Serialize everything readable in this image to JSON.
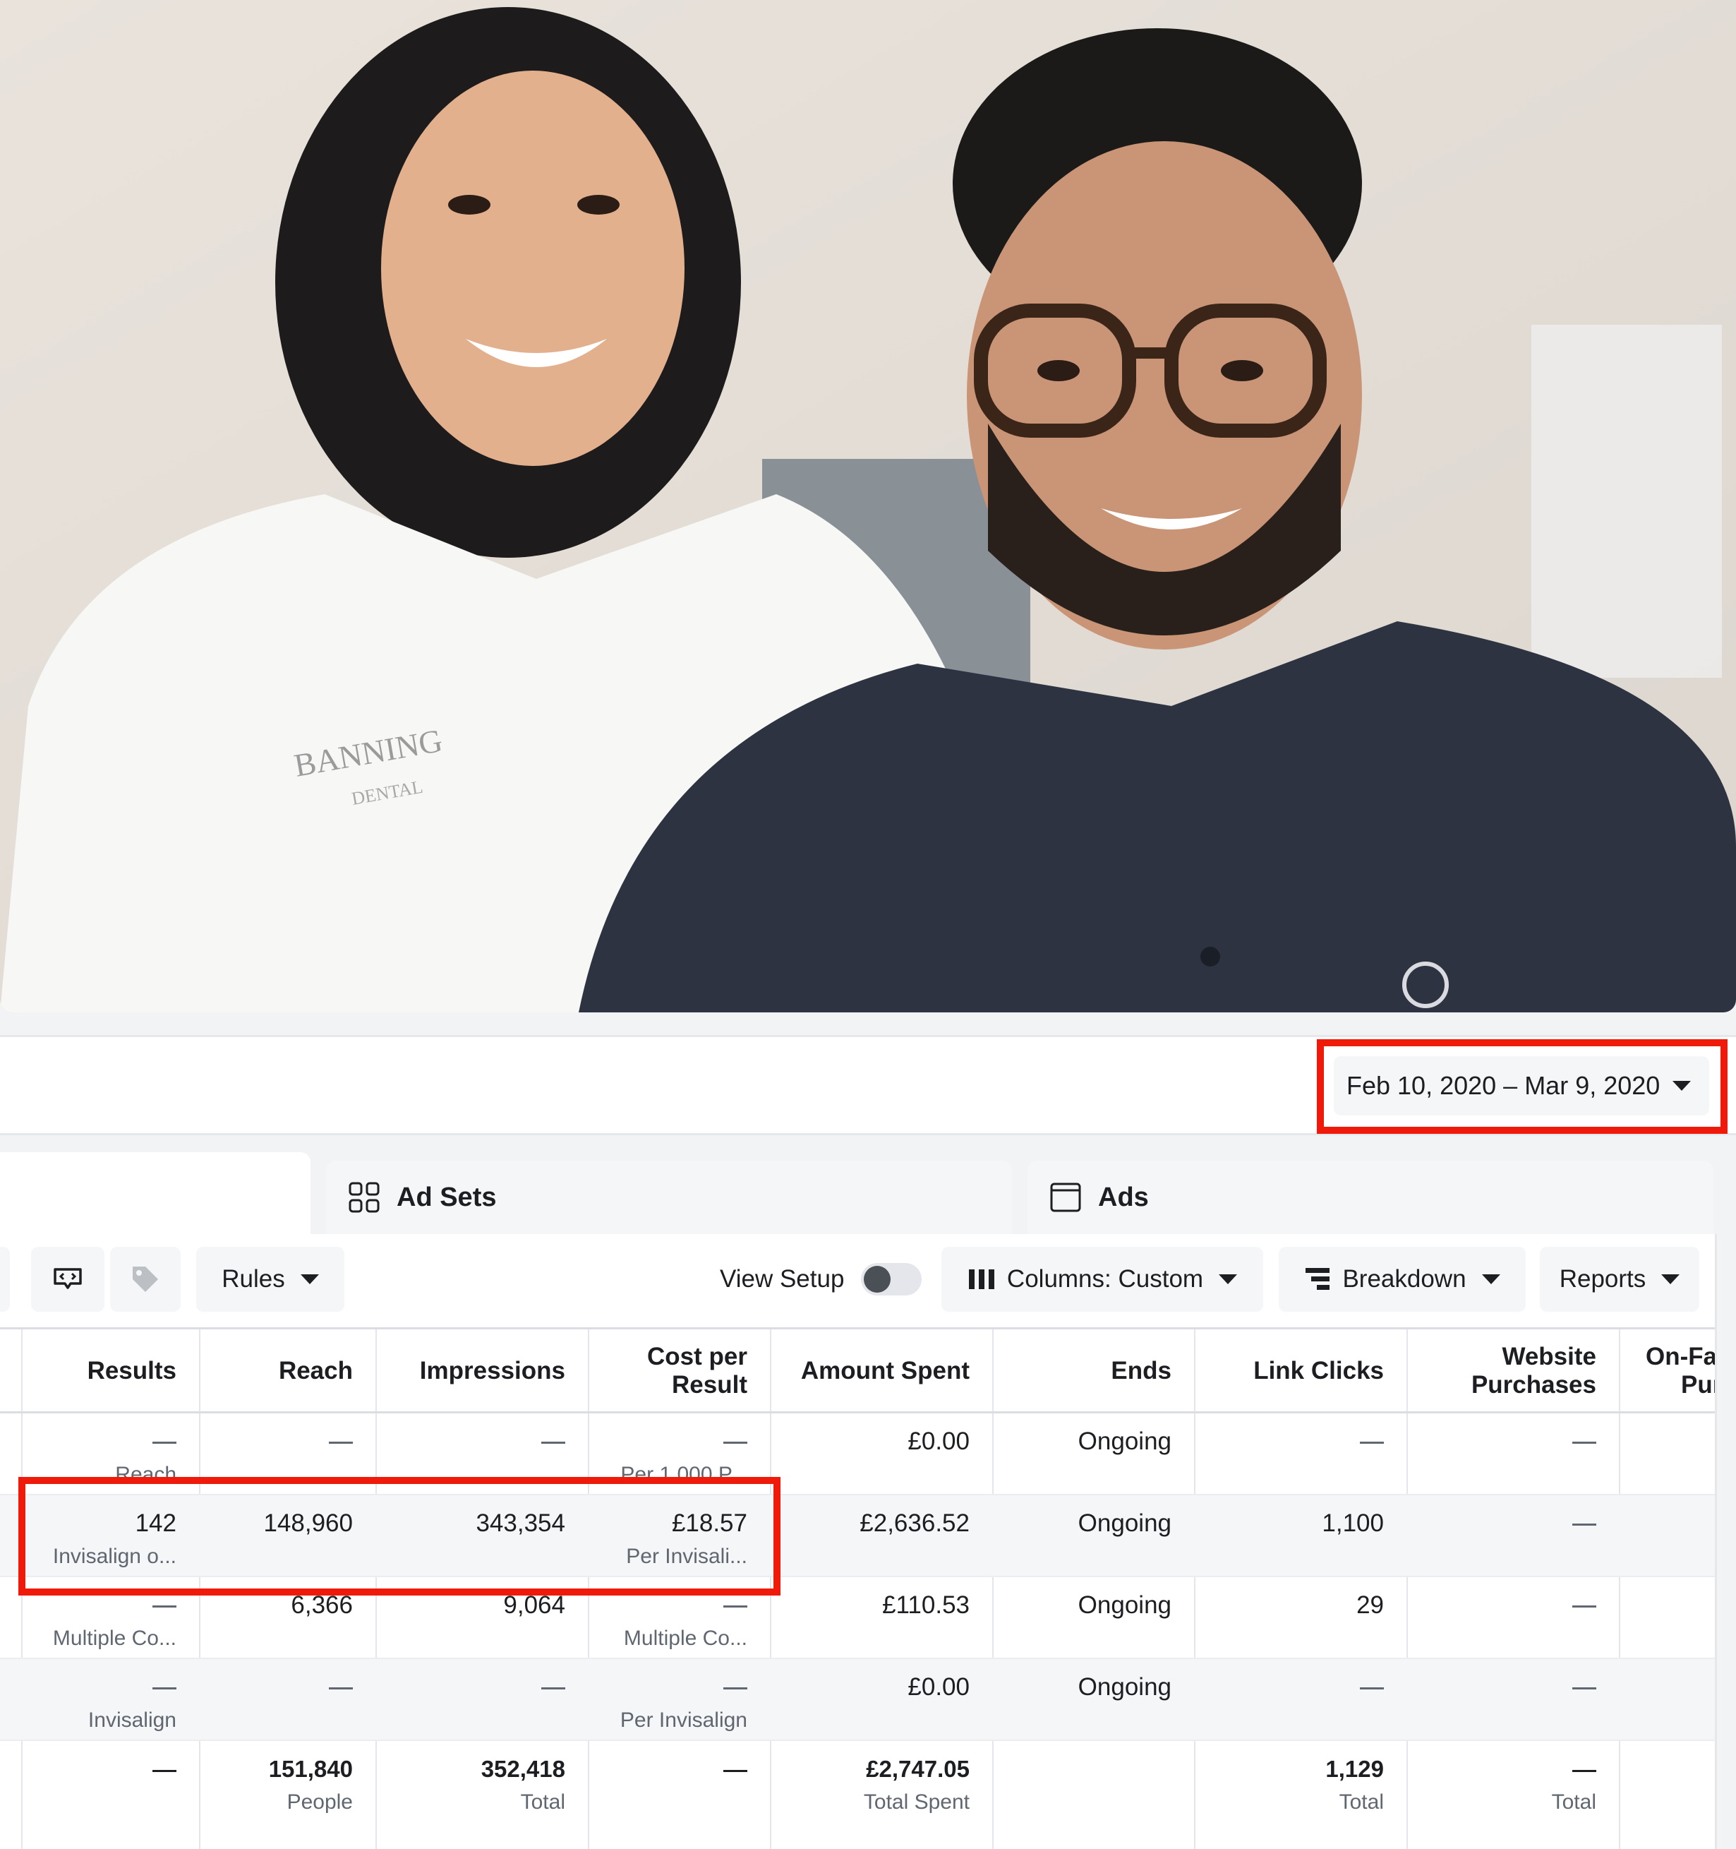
{
  "date_range": {
    "label": "Feb 10, 2020 – Mar 9, 2020"
  },
  "photo": {
    "shirt_logo_text": "BANNING",
    "shirt_logo_sub": "DENTAL"
  },
  "tabs": [
    {
      "label": "Ad Sets",
      "icon": "ad-sets-grid-icon"
    },
    {
      "label": "Ads",
      "icon": "ads-window-icon"
    }
  ],
  "toolbar": {
    "rules": "Rules",
    "view_setup": "View Setup",
    "columns": "Columns: Custom",
    "breakdown": "Breakdown",
    "reports": "Reports"
  },
  "table": {
    "headers": {
      "results": "Results",
      "reach": "Reach",
      "impressions": "Impressions",
      "cost_1": "Cost per",
      "cost_2": "Result",
      "amount_spent": "Amount Spent",
      "ends": "Ends",
      "link_clicks": "Link Clicks",
      "website_1": "Website",
      "website_2": "Purchases",
      "onfb_1": "On-Fac",
      "onfb_2": "Purc"
    },
    "rows": [
      {
        "results": "",
        "results_sub": "Reach",
        "reach": "",
        "impressions": "",
        "cost": "",
        "cost_sub": "Per 1,000 P...",
        "amount": "£0.00",
        "ends": "Ongoing",
        "clicks": "",
        "purchases": ""
      },
      {
        "results": "142",
        "results_sub": "Invisalign o...",
        "reach": "148,960",
        "impressions": "343,354",
        "cost": "£18.57",
        "cost_sub": "Per Invisali...",
        "amount": "£2,636.52",
        "ends": "Ongoing",
        "clicks": "1,100",
        "purchases": ""
      },
      {
        "results": "",
        "results_sub": "Multiple Co...",
        "reach": "6,366",
        "impressions": "9,064",
        "cost": "",
        "cost_sub": "Multiple Co...",
        "amount": "£110.53",
        "ends": "Ongoing",
        "clicks": "29",
        "purchases": ""
      },
      {
        "results": "",
        "results_sub": "Invisalign",
        "reach": "",
        "impressions": "",
        "cost": "",
        "cost_sub": "Per Invisalign",
        "amount": "£0.00",
        "ends": "Ongoing",
        "clicks": "",
        "purchases": ""
      }
    ],
    "totals": {
      "reach": "151,840",
      "reach_sub": "People",
      "impressions": "352,418",
      "impressions_sub": "Total",
      "amount": "£2,747.05",
      "amount_sub": "Total Spent",
      "clicks": "1,129",
      "clicks_sub": "Total",
      "purchases_sub": "Total"
    }
  },
  "colors": {
    "highlight": "#f01a0a",
    "text": "#1c1e21",
    "muted": "#606770"
  }
}
